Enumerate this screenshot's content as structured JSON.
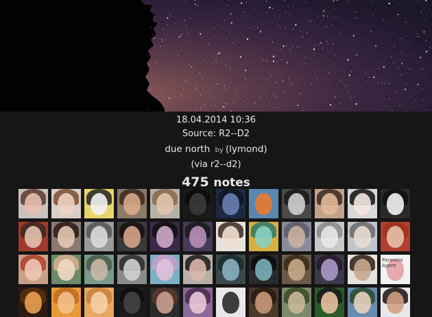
{
  "post": {
    "date": "18.04.2014 10:36",
    "source_label": "Source:",
    "source_name": "R2--D2",
    "title": "due north",
    "by_label": "by",
    "author_paren_open": "(",
    "author": "lymond",
    "author_paren_close": ")",
    "via": "(via r2--d2)",
    "notes_count": "475",
    "notes_label": "notes"
  },
  "avatars": [
    {
      "bg": "#c9c2be",
      "skin": "#e8bfae",
      "hair": "#5a3a2e"
    },
    {
      "bg": "#d9cfc8",
      "skin": "#f0d0bf",
      "hair": "#7a4e32"
    },
    {
      "bg": "#e7d56a",
      "skin": "#f2f2f2",
      "hair": "#222222"
    },
    {
      "bg": "#8a7a68",
      "skin": "#d8a98a",
      "hair": "#3e2a1e"
    },
    {
      "bg": "#b7b0a6",
      "skin": "#e2c4b0",
      "hair": "#8b6a4a"
    },
    {
      "bg": "#1a1a1a",
      "skin": "#3b3b3b",
      "hair": "#0d0d0d"
    },
    {
      "bg": "#1d2a46",
      "skin": "#6a7fb0",
      "hair": "#0f1624"
    },
    {
      "bg": "#5a86b2",
      "skin": "#e67a2e",
      "hair": "#5a86b2"
    },
    {
      "bg": "#4a4a4a",
      "skin": "#cfcfcf",
      "hair": "#1a1a1a"
    },
    {
      "bg": "#bfa28a",
      "skin": "#e3b89a",
      "hair": "#3a2a22"
    },
    {
      "bg": "#d7d7d7",
      "skin": "#f2e6df",
      "hair": "#111111"
    },
    {
      "bg": "#2a2a2a",
      "skin": "#f2f2f2",
      "hair": "#101010"
    },
    {
      "bg": "#a03a2a",
      "skin": "#e2c2b0",
      "hair": "#3a2a22"
    },
    {
      "bg": "#8b7a70",
      "skin": "#e4c7b4",
      "hair": "#2a1a14"
    },
    {
      "bg": "#9a9a9a",
      "skin": "#dadada",
      "hair": "#555555"
    },
    {
      "bg": "#3a3a3a",
      "skin": "#d6a28a",
      "hair": "#1a1010"
    },
    {
      "bg": "#3a2a4a",
      "skin": "#cfa8c8",
      "hair": "#101010"
    },
    {
      "bg": "#4a3a5a",
      "skin": "#b890b8",
      "hair": "#1a1a1a"
    },
    {
      "bg": "#e8e2dc",
      "skin": "#f2ded0",
      "hair": "#3a2a22"
    },
    {
      "bg": "#d8b040",
      "skin": "#8ad0c0",
      "hair": "#2c7a6a"
    },
    {
      "bg": "#8a8a9a",
      "skin": "#c9b0a0",
      "hair": "#5a5a6a"
    },
    {
      "bg": "#c8c8c8",
      "skin": "#e8e8e8",
      "hair": "#8a8a8a"
    },
    {
      "bg": "#bfc6cc",
      "skin": "#e8dcd4",
      "hair": "#6a6a6a"
    },
    {
      "bg": "#b04030",
      "skin": "#e8c0a8",
      "hair": "#a0321e"
    },
    {
      "bg": "#c8a088",
      "skin": "#ecc8b4",
      "hair": "#b0402a"
    },
    {
      "bg": "#6a8a6a",
      "skin": "#f0d8c4",
      "hair": "#d6b090"
    },
    {
      "bg": "#7a9a8a",
      "skin": "#c8b8a8",
      "hair": "#4a5a4a"
    },
    {
      "bg": "#8a8a8a",
      "skin": "#d0d0d0",
      "hair": "#2a2a2a"
    },
    {
      "bg": "#7ab0c8",
      "skin": "#e0c0d8",
      "hair": "#c8a0c8"
    },
    {
      "bg": "#b8b0a8",
      "skin": "#d8b8a8",
      "hair": "#1a1a1a"
    },
    {
      "bg": "#3a4a4a",
      "skin": "#8ab0c0",
      "hair": "#1a2a2a"
    },
    {
      "bg": "#2a2a2a",
      "skin": "#7ab0b8",
      "hair": "#0a0a0a"
    },
    {
      "bg": "#6a5a4a",
      "skin": "#c8a888",
      "hair": "#3a2a1a"
    },
    {
      "bg": "#3a3a4a",
      "skin": "#a898c8",
      "hair": "#2a1a2a"
    },
    {
      "bg": "#e6e2de",
      "skin": "#c8a890",
      "hair": "#2a1a12"
    },
    {
      "bg": "#f2f2f2",
      "skin": "#e6a0a8",
      "hair": "#f2f2f2",
      "text": "Paranoia Agent"
    },
    {
      "bg": "#2a1a10",
      "skin": "#e8a050",
      "hair": "#5a3010"
    },
    {
      "bg": "#e89a3a",
      "skin": "#f2c08a",
      "hair": "#c06a20"
    },
    {
      "bg": "#e8a860",
      "skin": "#f4d0a8",
      "hair": "#c88040"
    },
    {
      "bg": "#1a1a1a",
      "skin": "#444444",
      "hair": "#101010"
    },
    {
      "bg": "#2a2a2a",
      "skin": "#c8a090",
      "hair": "#5a3a2a"
    },
    {
      "bg": "#8a6a9a",
      "skin": "#e8c8d8",
      "hair": "#4a2a4a"
    },
    {
      "bg": "#e8e8e8",
      "skin": "#2a2a2a",
      "hair": "#e8e8e8"
    },
    {
      "bg": "#4a3a2a",
      "skin": "#c89878",
      "hair": "#2a1a10"
    },
    {
      "bg": "#7a8a6a",
      "skin": "#c8b898",
      "hair": "#3a4a2a"
    },
    {
      "bg": "#2a5a2a",
      "skin": "#e8c0a0",
      "hair": "#1a1a1a"
    },
    {
      "bg": "#6a8ab0",
      "skin": "#e8d0c0",
      "hair": "#2a4a2a"
    },
    {
      "bg": "#e8e8e8",
      "skin": "#d0a080",
      "hair": "#1a1010"
    }
  ],
  "colors": {
    "page_bg": "#161616",
    "text": "#eaeaea",
    "muted": "#bbbbbb"
  }
}
